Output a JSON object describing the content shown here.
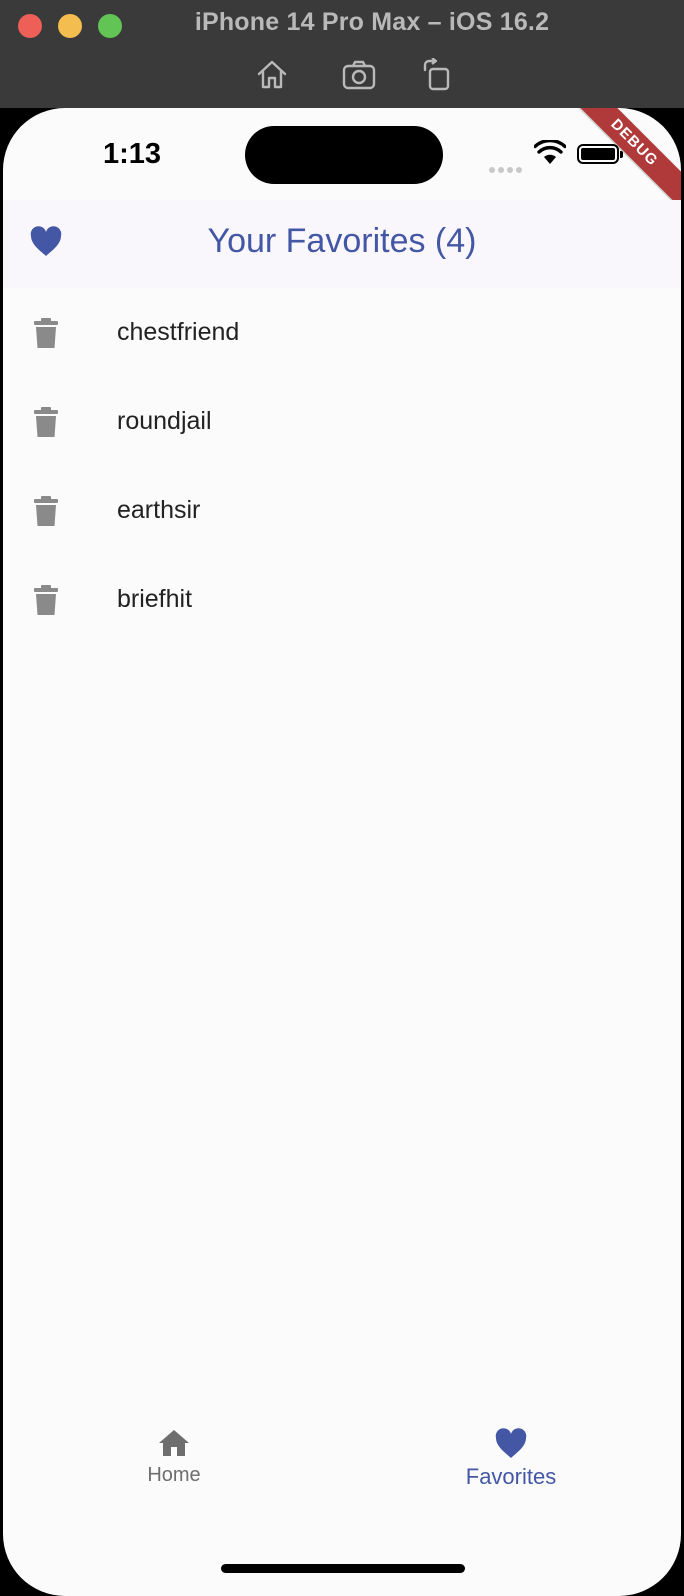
{
  "window": {
    "title": "iPhone 14 Pro Max – iOS 16.2",
    "toolbar_icons": [
      "home-icon",
      "screenshot-icon",
      "rotate-icon"
    ]
  },
  "status_bar": {
    "time": "1:13",
    "icons": [
      "wifi-icon",
      "battery-icon"
    ]
  },
  "debug_banner": "DEBUG",
  "app_bar": {
    "icon": "heart-icon",
    "title": "Your Favorites (4)"
  },
  "favorites": [
    {
      "label": "chestfriend",
      "icon": "trash-icon"
    },
    {
      "label": "roundjail",
      "icon": "trash-icon"
    },
    {
      "label": "earthsir",
      "icon": "trash-icon"
    },
    {
      "label": "briefhit",
      "icon": "trash-icon"
    }
  ],
  "bottom_nav": {
    "items": [
      {
        "label": "Home",
        "icon": "home-icon",
        "selected": false
      },
      {
        "label": "Favorites",
        "icon": "heart-icon",
        "selected": true
      }
    ]
  },
  "colors": {
    "accent": "#4457a5",
    "icon_gray": "#8a8a8a",
    "background": "#fbfbfb",
    "app_bar_bg": "#f9f7fc",
    "debug_banner": "#b03a3a"
  }
}
